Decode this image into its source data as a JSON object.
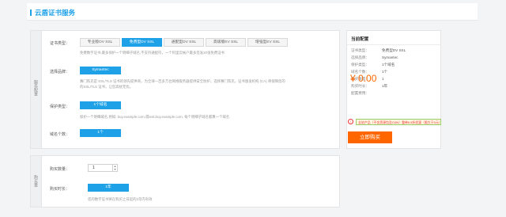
{
  "header": {
    "title": "云盾证书服务"
  },
  "config": {
    "side_label": "服务配置",
    "cert_type_label": "证书类型：",
    "cert_types": [
      "专业版OV SSL",
      "免费型DV SSL",
      "通配型DV SSL",
      "高级版EV SSL",
      "增强型EV SSL"
    ],
    "cert_type_hint": "免费数字证书,最多保护一个明细子域名,不支持通配符，一个阿里云帐户最多签发20张免费证书",
    "brand_label": "选择品牌：",
    "brand_value": "Symantec",
    "brand_hint_1": "赛门铁克是 SSL/TLS 证书的领先提供商，为全球一百多万台网络服务器提供安全防护。选择赛门铁克，证书颁发机构 (CA) 将保障您的",
    "brand_hint_2": "的SSL/TLS 证书，让您高枕无忧。",
    "domain_type_label": "保护类型：",
    "domain_type_value": "1个域名",
    "domain_type_hint": "保护一个明细域名,例如: buy.example.com,或test.buy.example.com, 每个明细子域名都算一个域名",
    "domain_count_label": "域名个数：",
    "domain_count_value": "1个"
  },
  "purchase": {
    "side_label": "购买量",
    "qty_label": "购买数量：",
    "qty_value": "1",
    "duration_label": "购买时长：",
    "duration_value": "1年",
    "duration_hint": "您的数字证书将在购买之日起的1年内有效"
  },
  "summary": {
    "title": "当前配置",
    "rows": [
      {
        "key": "证书类型：",
        "value": "免费型DV SSL"
      },
      {
        "key": "选择品牌：",
        "value": "Symantec"
      },
      {
        "key": "保护类型：",
        "value": "1个域名"
      },
      {
        "key": "域名个数：",
        "value": "1个"
      },
      {
        "key": "购买数量：",
        "value": "1"
      },
      {
        "key": "购买时长：",
        "value": "1年"
      },
      {
        "key": "配置费用：",
        "value": ""
      }
    ],
    "price": "¥ 0.00",
    "notice_icon": "exclamation-icon",
    "notice": "全站产品（不含资源包及CDN）整单6.5折优惠（限大于5元）",
    "buy_label": "立即购买"
  },
  "colors": {
    "accent": "#1fa1e8",
    "buy": "#ff6600",
    "price": "#ff6600"
  }
}
